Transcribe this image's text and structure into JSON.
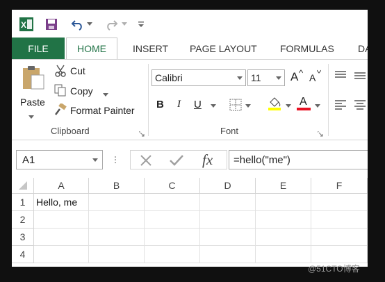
{
  "quick_access": {
    "app_icon": "excel-logo-icon",
    "save_icon": "save-icon",
    "undo_icon": "undo-icon",
    "redo_icon": "redo-icon",
    "customize_icon": "customize-qat-icon"
  },
  "tabs": [
    {
      "label": "FILE"
    },
    {
      "label": "HOME"
    },
    {
      "label": "INSERT"
    },
    {
      "label": "PAGE LAYOUT"
    },
    {
      "label": "FORMULAS"
    },
    {
      "label": "DA"
    }
  ],
  "clipboard": {
    "paste_label": "Paste",
    "cut_label": "Cut",
    "copy_label": "Copy",
    "format_painter_label": "Format Painter",
    "group_label": "Clipboard"
  },
  "font": {
    "font_name": "Calibri",
    "font_size": "11",
    "grow_label": "A",
    "shrink_label": "A",
    "bold_label": "B",
    "italic_label": "I",
    "underline_label": "U",
    "font_color_label": "A",
    "group_label": "Font",
    "fill_color": "#ffff00",
    "font_color": "#e81123"
  },
  "formula_bar": {
    "name_box": "A1",
    "fx_label": "fx",
    "formula": "=hello(\"me\")"
  },
  "sheet": {
    "columns": [
      "A",
      "B",
      "C",
      "D",
      "E",
      "F"
    ],
    "rows": [
      {
        "num": "1",
        "cells": [
          "Hello, me",
          "",
          "",
          "",
          "",
          ""
        ]
      },
      {
        "num": "2",
        "cells": [
          "",
          "",
          "",
          "",
          "",
          ""
        ]
      },
      {
        "num": "3",
        "cells": [
          "",
          "",
          "",
          "",
          "",
          ""
        ]
      },
      {
        "num": "4",
        "cells": [
          "",
          "",
          "",
          "",
          "",
          ""
        ]
      }
    ]
  },
  "watermark": "@51CTO博客",
  "colors": {
    "brand": "#217346",
    "background": "#101010"
  }
}
